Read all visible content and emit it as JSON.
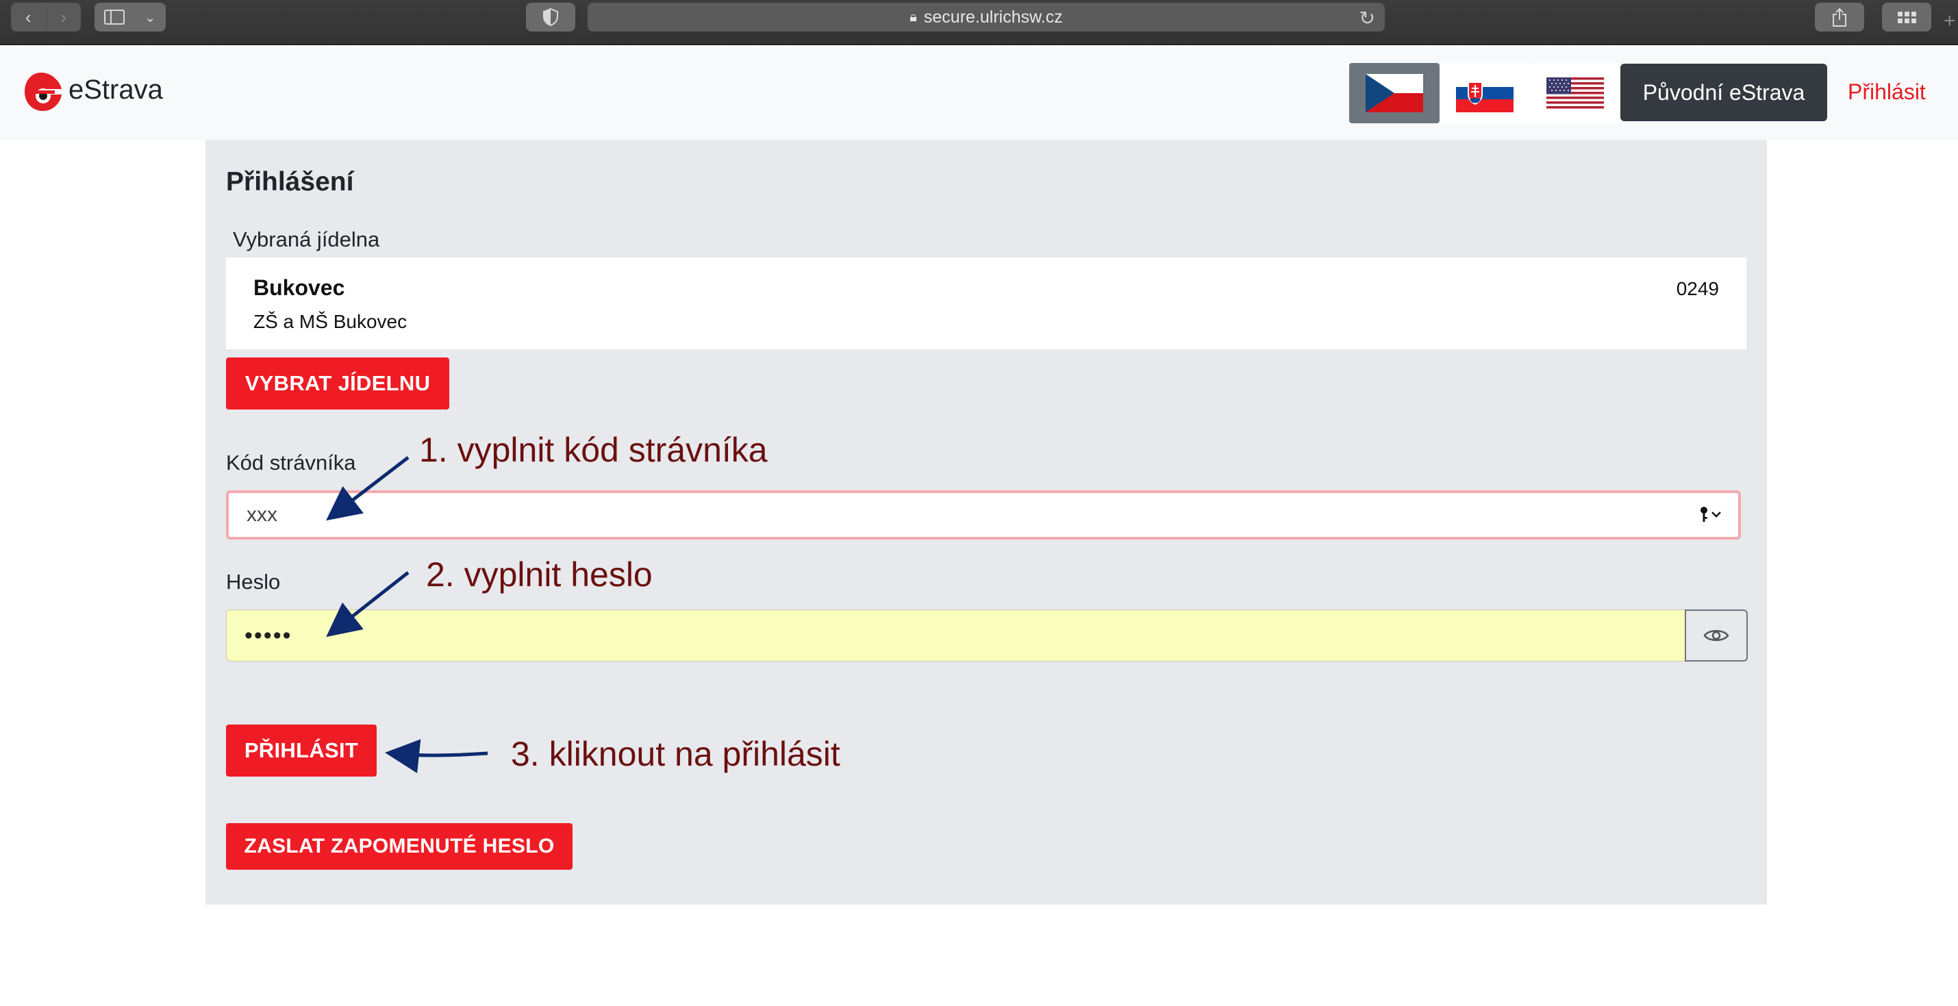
{
  "browser": {
    "url": "secure.ulrichsw.cz"
  },
  "header": {
    "brand": "eStrava",
    "languages": [
      {
        "code": "cs",
        "flag": "czech-flag",
        "active": true
      },
      {
        "code": "sk",
        "flag": "slovak-flag",
        "active": false
      },
      {
        "code": "en",
        "flag": "us-flag",
        "active": false
      }
    ],
    "original_button": "Původní eStrava",
    "login_link": "Přihlásit",
    "accent_color": "#e31e24"
  },
  "form": {
    "title": "Přihlášení",
    "selected_canteen_label": "Vybraná jídelna",
    "canteen": {
      "name": "Bukovec",
      "full_name": "ZŠ a MŠ Bukovec",
      "code": "0249"
    },
    "choose_canteen_button": "VYBRAT JÍDELNU",
    "code_label": "Kód strávníka",
    "code_value": "xxx",
    "password_label": "Heslo",
    "password_value": "•••••",
    "login_button": "PŘIHLÁSIT",
    "forgot_button": "ZASLAT ZAPOMENUTÉ HESLO",
    "button_color": "#ef1c25"
  },
  "annotations": {
    "step1": "1. vyplnit kód strávníka",
    "step2": "2. vyplnit heslo",
    "step3": "3. kliknout na přihlásit",
    "text_color": "#6b0f0f",
    "arrow_color": "#0d2b6e"
  }
}
